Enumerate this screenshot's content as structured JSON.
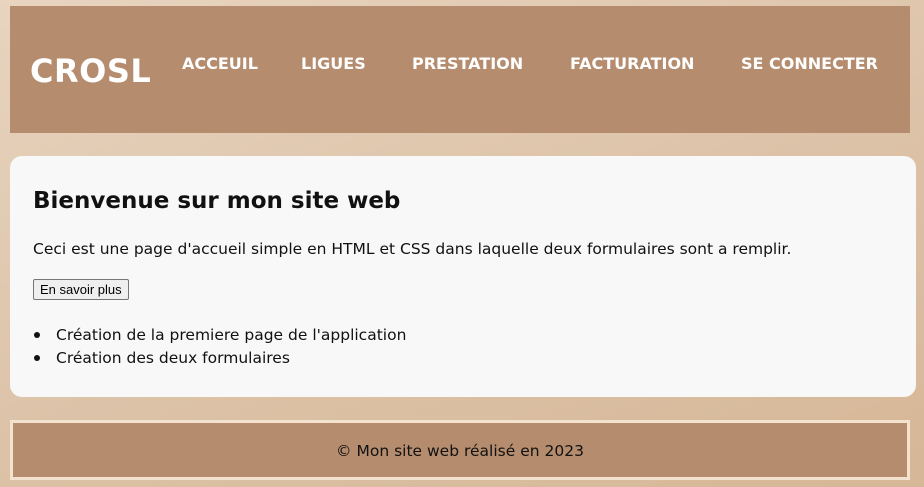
{
  "header": {
    "logo": "CROSL",
    "nav": [
      "ACCEUIL",
      "LIGUES",
      "PRESTATION",
      "FACTURATION",
      "SE CONNECTER"
    ]
  },
  "main": {
    "title": "Bienvenue sur mon site web",
    "intro": "Ceci est une page d'accueil simple en HTML et CSS dans laquelle deux formulaires sont a remplir.",
    "button_label": "En savoir plus",
    "features": [
      "Création de la premiere page de l'application",
      "Création des deux formulaires"
    ]
  },
  "footer": {
    "text": "© Mon site web réalisé en 2023"
  },
  "colors": {
    "header_bg": "#b58d6e",
    "card_bg": "#f8f8f8",
    "footer_border": "#f3e2cd"
  }
}
